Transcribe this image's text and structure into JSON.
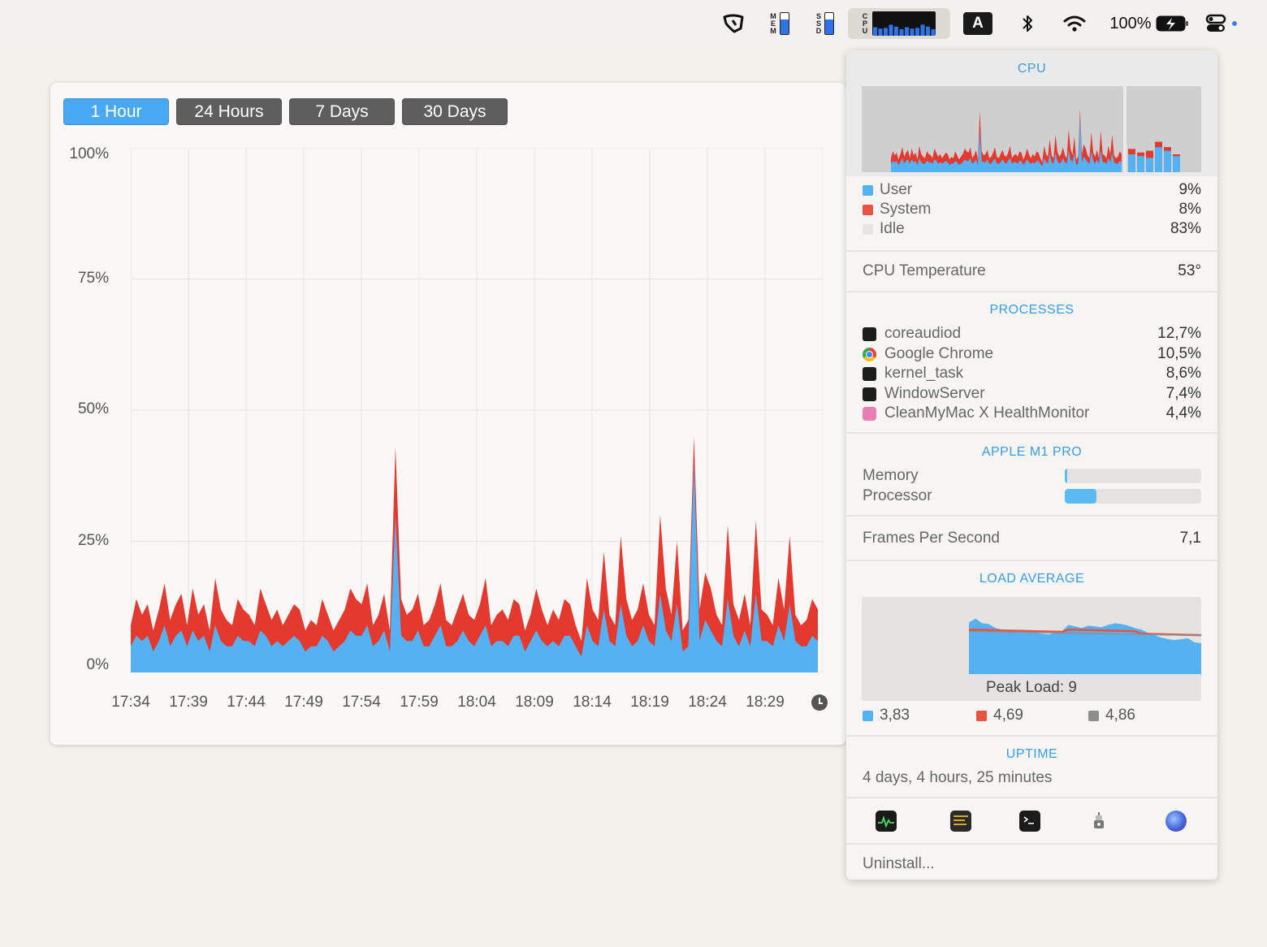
{
  "menubar": {
    "mem_label": [
      "M",
      "E",
      "M"
    ],
    "ssd_label": [
      "S",
      "S",
      "D"
    ],
    "cpu_label": [
      "C",
      "P",
      "U"
    ],
    "input_source": "A",
    "battery": "100%",
    "icons": [
      "monitor-icon",
      "memory-gauge-icon",
      "ssd-gauge-icon",
      "cpu-graph-icon",
      "input-source-icon",
      "bluetooth-icon",
      "wifi-icon",
      "battery-charging-icon",
      "control-center-icon"
    ],
    "mem_fill_pct": 70,
    "ssd_fill_pct": 70
  },
  "history": {
    "ranges": [
      "1 Hour",
      "24 Hours",
      "7 Days",
      "30 Days"
    ],
    "active_range": 0,
    "clock_icon": "clock-icon"
  },
  "chart_data": {
    "type": "area",
    "y_tick_labels": [
      "100%",
      "75%",
      "50%",
      "25%",
      "0%"
    ],
    "x_tick_labels": [
      "17:34",
      "17:39",
      "17:44",
      "17:49",
      "17:54",
      "17:59",
      "18:04",
      "18:09",
      "18:14",
      "18:19",
      "18:24",
      "18:29"
    ],
    "ylim": [
      0,
      100
    ],
    "grid": true,
    "colors": {
      "user": "#56b1f2",
      "system": "#e3392f"
    },
    "series_note_x_range": [
      "17:34",
      "18:34"
    ],
    "total": [
      9,
      14,
      11,
      13,
      8,
      12,
      17,
      10,
      13,
      15,
      9,
      16,
      11,
      13,
      8,
      18,
      12,
      10,
      9,
      14,
      12,
      11,
      9,
      16,
      13,
      10,
      12,
      9,
      11,
      13,
      12,
      8,
      10,
      9,
      14,
      11,
      8,
      10,
      12,
      16,
      14,
      13,
      17,
      9,
      11,
      15,
      8,
      43,
      14,
      11,
      12,
      15,
      9,
      10,
      13,
      17,
      10,
      9,
      12,
      15,
      11,
      10,
      13,
      18,
      9,
      11,
      12,
      10,
      14,
      13,
      8,
      11,
      16,
      12,
      9,
      12,
      10,
      14,
      13,
      9,
      6,
      18,
      12,
      10,
      23,
      11,
      9,
      26,
      14,
      10,
      12,
      17,
      11,
      9,
      30,
      16,
      11,
      25,
      8,
      10,
      45,
      12,
      19,
      16,
      11,
      9,
      28,
      13,
      10,
      15,
      9,
      29,
      12,
      11,
      9,
      18,
      12,
      26,
      11,
      9,
      10,
      14,
      12
    ],
    "user": [
      5,
      7,
      6,
      7,
      4,
      6,
      9,
      5,
      7,
      8,
      5,
      8,
      6,
      7,
      4,
      9,
      6,
      5,
      5,
      7,
      6,
      6,
      5,
      8,
      7,
      5,
      6,
      5,
      6,
      7,
      6,
      4,
      5,
      5,
      7,
      6,
      4,
      5,
      6,
      8,
      7,
      7,
      9,
      5,
      6,
      8,
      4,
      30,
      7,
      6,
      6,
      8,
      5,
      5,
      7,
      9,
      5,
      5,
      6,
      8,
      6,
      5,
      7,
      9,
      5,
      6,
      6,
      5,
      7,
      7,
      4,
      6,
      8,
      6,
      5,
      6,
      5,
      7,
      7,
      5,
      3,
      9,
      6,
      5,
      12,
      6,
      5,
      13,
      7,
      5,
      6,
      9,
      6,
      5,
      15,
      8,
      6,
      13,
      4,
      5,
      40,
      6,
      10,
      8,
      6,
      5,
      14,
      7,
      5,
      8,
      5,
      15,
      6,
      6,
      5,
      9,
      6,
      13,
      6,
      5,
      5,
      7,
      6
    ]
  },
  "panel": {
    "cpu_title": "CPU",
    "cpu_summary_totals": [
      13,
      11,
      12,
      17,
      14,
      10
    ],
    "cpu_summary_system": [
      3,
      2,
      4,
      3,
      2,
      1
    ],
    "cpu_breakdown": [
      {
        "label": "User",
        "value": "9%",
        "color": "#56b1f2"
      },
      {
        "label": "System",
        "value": "8%",
        "color": "#e8533f"
      },
      {
        "label": "Idle",
        "value": "83%",
        "color": "#e6e5e3"
      }
    ],
    "temperature": {
      "label": "CPU Temperature",
      "value": "53°"
    },
    "processes_title": "PROCESSES",
    "processes": [
      {
        "name": "coreaudiod",
        "value": "12,7%",
        "icon": "terminal-icon"
      },
      {
        "name": "Google Chrome",
        "value": "10,5%",
        "icon": "chrome-icon"
      },
      {
        "name": "kernel_task",
        "value": "8,6%",
        "icon": "terminal-icon"
      },
      {
        "name": "WindowServer",
        "value": "7,4%",
        "icon": "terminal-icon"
      },
      {
        "name": "CleanMyMac X HealthMonitor",
        "value": "4,4%",
        "icon": "cleanmymac-icon"
      }
    ],
    "chip_title": "APPLE M1 PRO",
    "chip_bars": [
      {
        "label": "Memory",
        "fill_pct": 2
      },
      {
        "label": "Processor",
        "fill_pct": 23
      }
    ],
    "fps": {
      "label": "Frames Per Second",
      "value": "7,1"
    },
    "load_title": "LOAD AVERAGE",
    "peak_load": "Peak Load: 9",
    "load_legend": [
      {
        "value": "3,83",
        "color": "#56b1f2"
      },
      {
        "value": "4,69",
        "color": "#e8533f"
      },
      {
        "value": "4,86",
        "color": "#8e8e8e"
      }
    ],
    "load_series": [
      6.5,
      7,
      6.4,
      6.3,
      5.8,
      5.6,
      5.5,
      5.4,
      5.3,
      5.3,
      5.2,
      5.1,
      5.0,
      5.2,
      5.4,
      6.2,
      6.0,
      5.8,
      6.1,
      6.0,
      5.9,
      6.2,
      6.4,
      6.3,
      6.1,
      5.8,
      5.6,
      5.2,
      4.9,
      4.6,
      4.4,
      4.3,
      4.4,
      4.5,
      4.0,
      3.9
    ],
    "uptime_title": "UPTIME",
    "uptime": "4 days, 4 hours, 25 minutes",
    "tools": [
      "activity-monitor-icon",
      "console-icon",
      "terminal-icon",
      "system-info-icon",
      "cleanmymac-app-icon"
    ],
    "uninstall": "Uninstall..."
  }
}
